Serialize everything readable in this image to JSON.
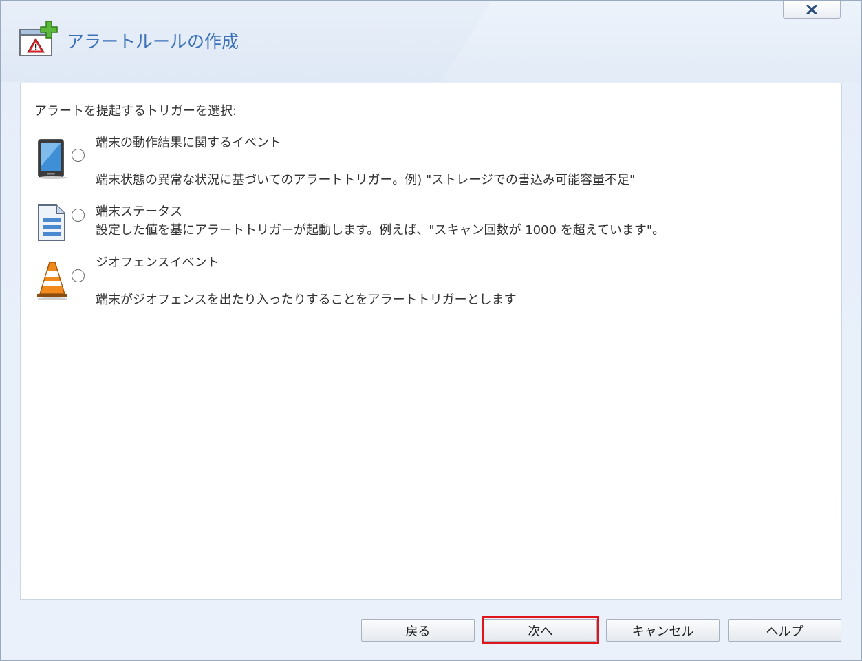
{
  "dialog": {
    "title": "アラートルールの作成",
    "icon": "alert-add-icon",
    "close_icon": "close-icon"
  },
  "content": {
    "prompt": "アラートを提起するトリガーを選択:",
    "options": [
      {
        "label": "端末の動作結果に関するイベント",
        "description": "端末状態の異常な状況に基づいてのアラートトリガー。例) \"ストレージでの書込み可能容量不足\"",
        "icon": "mobile-device-icon",
        "selected": false
      },
      {
        "label": "端末ステータス",
        "description": "設定した値を基にアラートトリガーが起動します。例えば、\"スキャン回数が 1000 を超えています\"。",
        "icon": "document-status-icon",
        "selected": false
      },
      {
        "label": "ジオフェンスイベント",
        "description": "端末がジオフェンスを出たり入ったりすることをアラートトリガーとします",
        "icon": "traffic-cone-icon",
        "selected": false
      }
    ]
  },
  "buttons": {
    "back": "戻る",
    "next": "次へ",
    "cancel": "キャンセル",
    "help": "ヘルプ"
  },
  "colors": {
    "title": "#3d72b8",
    "highlight": "#e0141b",
    "background": "#e6eef9"
  }
}
